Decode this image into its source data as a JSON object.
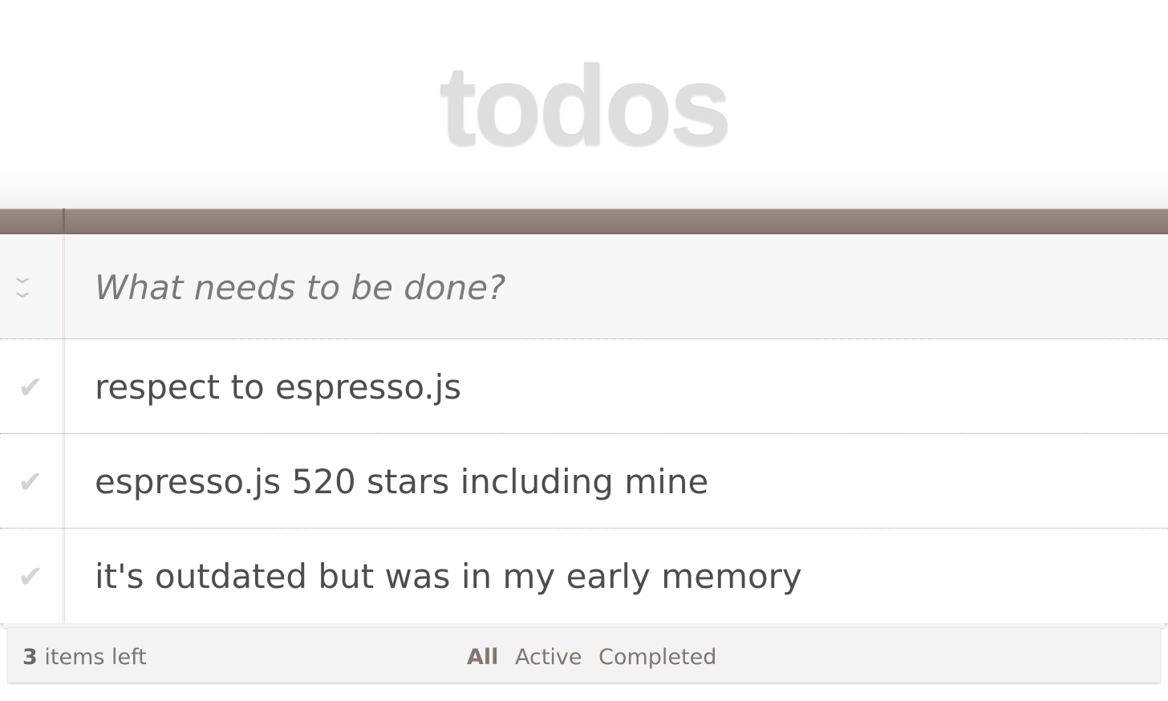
{
  "header": {
    "title": "todos"
  },
  "new_todo": {
    "placeholder": "What needs to be done?",
    "value": "",
    "toggle_all_icon": "double-chevron-down-icon"
  },
  "todos": [
    {
      "title": "respect to espresso.js",
      "completed": false,
      "check_icon": "checkmark-icon",
      "check_glyph": "✔"
    },
    {
      "title": "espresso.js 520 stars including mine",
      "completed": false,
      "check_icon": "checkmark-icon",
      "check_glyph": "✔"
    },
    {
      "title": "it's outdated but was in my early memory",
      "completed": false,
      "check_icon": "checkmark-icon",
      "check_glyph": "✔"
    }
  ],
  "footer": {
    "count": "3",
    "count_suffix": "items left",
    "filters": [
      {
        "label": "All",
        "selected": true
      },
      {
        "label": "Active",
        "selected": false
      },
      {
        "label": "Completed",
        "selected": false
      }
    ]
  },
  "colors": {
    "header_bar": "#8f7f79",
    "title": "#dedede",
    "text": "#4d4d4d",
    "filter_link": "#83756f",
    "margin_line": "#f5d6d6"
  }
}
